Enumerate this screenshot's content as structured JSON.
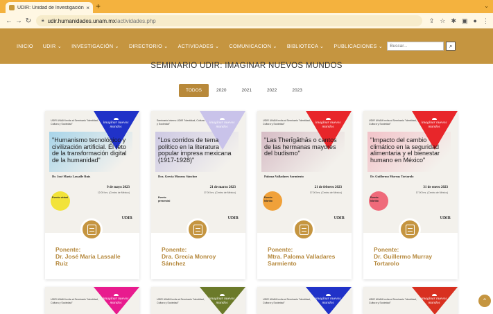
{
  "browser": {
    "tab_title": "UDIR: Unidad de Investigación",
    "tab_close": "×",
    "new_tab": "+",
    "url_host": "udir.humanidades.unam.mx",
    "url_path": "/actividades.php"
  },
  "nav": {
    "items": [
      "INICIO",
      "UDIR ⌄",
      "INVESTIGACIÓN ⌄",
      "DIRECTORIO ⌄",
      "ACTIVIDADES ⌄",
      "COMUNICACION ⌄",
      "BIBLIOTECA ⌄",
      "PUBLICACIONES ⌄"
    ],
    "search_placeholder": "Buscar..."
  },
  "page": {
    "title": "SEMINARIO UDIR: IMAGINAR NUEVOS MUNDOS",
    "filters": [
      "TODOS",
      "2020",
      "2021",
      "2022",
      "2023"
    ],
    "active_filter": "TODOS"
  },
  "colors": {
    "brand": "#c59540",
    "accent_text": "#b5883c"
  },
  "cards": [
    {
      "label": "Ponente:",
      "name": "Dr. José María Lassalle Ruiz",
      "poster_head": "UDIR UNAM invita al Seminario \"Identidad, Cultura y Sociedad\"",
      "tri_text": "imaginar nuevos mundos",
      "tri_color": "#2032c8",
      "quote": "\"Humanismo tecnológico y civilización artificial. El reto de la transformación digital de la humanidad\"",
      "speaker": "Dr. José María Lassalle Ruiz",
      "date": "9 de mayo 2023",
      "time": "12:00 hrs. (Centro de México)",
      "event": "Evento virtual",
      "circle_color": "#f2e33a",
      "art_color": "#7fc5e8"
    },
    {
      "label": "Ponente:",
      "name": "Dra. Grecia Monroy Sánchez",
      "poster_head": "Seminario Interno UDIR \"Identidad, Cultura y Sociedad\"",
      "tri_text": "imaginar nuevos mundos",
      "tri_color": "#c9c3ea",
      "quote": "\"Los corridos de tema político en la literatura popular impresa mexicana (1917-1928)\"",
      "speaker": "Dra. Grecia Monroy Sánchez",
      "date": "21 de marzo 2023",
      "time": "17:00 hrs. (Centro de México)",
      "event": "Evento presencial",
      "circle_color": "#f3f1ec",
      "art_color": "#b9b3df"
    },
    {
      "label": "Ponente:",
      "name": "Mtra. Paloma Valladares Sarmiento",
      "poster_head": "UDIR UNAM invita al Seminario \"Identidad, Cultura y Sociedad\"",
      "tri_text": "imaginar nuevos mundos",
      "tri_color": "#e8262a",
      "quote": "\"Las Therīgāthās o cantos de las hermanas mayores del budismo\"",
      "speaker": "Paloma Valladares Sarmiento",
      "date": "21 de febrero 2023",
      "time": "17:00 hrs. (Centro de México)",
      "event": "Evento híbrido",
      "circle_color": "#f0a13a",
      "art_color": "#c7a0b0"
    },
    {
      "label": "Ponente:",
      "name": "Dr. Guillermo Murray Tortarolo",
      "poster_head": "UDIR UNAM invita al Seminario \"Identidad, Cultura y Sociedad\"",
      "tri_text": "imaginar nuevos mundos",
      "tri_color": "#e8262a",
      "quote": "\"Impacto del cambio climático en la seguridad alimentaria y el bienestar humano en México\"",
      "speaker": "Dr. Guillermo Murray Tortarolo",
      "date": "31 de enero 2023",
      "time": "17:00 hrs. (Centro de México)",
      "event": "Evento híbrido",
      "circle_color": "#ef6a7a",
      "art_color": "#f2aab6"
    }
  ],
  "mini_cards": [
    {
      "poster_head": "UDIR UNAM invita al Seminario \"Identidad, Cultura y Sociedad\"",
      "tri_text": "imaginar nuevos mundos",
      "tri_color": "#e81b8e"
    },
    {
      "poster_head": "UDIR UNAM invita al Seminario \"Identidad, Cultura y Sociedad\"",
      "tri_text": "imaginar nuevos mundos",
      "tri_color": "#6b7a2a"
    },
    {
      "poster_head": "UDIR UNAM invita al Seminario \"Identidad, Cultura y Sociedad\"",
      "tri_text": "imaginar nuevos mundos",
      "tri_color": "#2032c8"
    },
    {
      "poster_head": "UDIR UNAM invita al Seminario \"Identidad, Cultura y Sociedad\"",
      "tri_text": "imaginar nuevos mundos",
      "tri_color": "#d83020"
    }
  ],
  "logos": [
    "UDIR"
  ],
  "scroll_top_icon": "⌃"
}
